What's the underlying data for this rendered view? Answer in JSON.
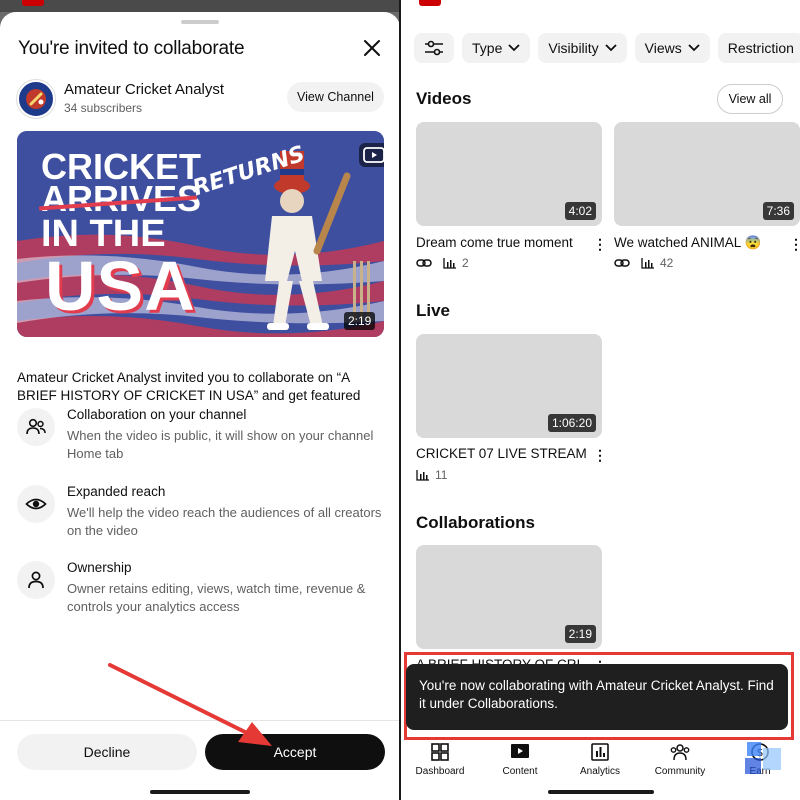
{
  "left": {
    "sheet_title": "You're invited to collaborate",
    "channel": {
      "name": "Amateur Cricket Analyst",
      "subscribers": "34 subscribers",
      "view_channel_label": "View Channel"
    },
    "thumbnail": {
      "line1": "CRICKET",
      "line2": "ARRIVES",
      "line2_overlay": "RETURNS",
      "line3": "IN THE",
      "line4": "USA",
      "duration": "2:19"
    },
    "invite_text": "Amateur Cricket Analyst invited you to collaborate on “A BRIEF HISTORY OF CRICKET IN USA” and get featured",
    "features": [
      {
        "icon": "people-icon",
        "title": "Collaboration on your channel",
        "desc": "When the video is public, it will show on your channel Home tab"
      },
      {
        "icon": "eye-icon",
        "title": "Expanded reach",
        "desc": "We'll help the video reach the audiences of all creators on the video"
      },
      {
        "icon": "person-icon",
        "title": "Ownership",
        "desc": "Owner retains editing, views, watch time, revenue & controls your analytics access"
      }
    ],
    "decline_label": "Decline",
    "accept_label": "Accept"
  },
  "right": {
    "filters": [
      "Type",
      "Visibility",
      "Views",
      "Restriction"
    ],
    "sections": {
      "videos": "Videos",
      "live": "Live",
      "collaborations": "Collaborations"
    },
    "view_all_label": "View all",
    "videos": [
      {
        "title": "Dream come true moment",
        "duration": "4:02",
        "views": "2"
      },
      {
        "title": "We watched ANIMAL 😨",
        "duration": "7:36",
        "views": "42"
      }
    ],
    "live": {
      "title": "CRICKET 07 LIVE STREAM",
      "duration": "1:06:20",
      "views": "11"
    },
    "collaboration": {
      "title": "A BRIEF HISTORY OF CRI",
      "duration": "2:19"
    },
    "toast": "You're now collaborating with Amateur Cricket Analyst. Find it under Collaborations.",
    "nav": [
      "Dashboard",
      "Content",
      "Analytics",
      "Community",
      "Earn"
    ]
  },
  "colors": {
    "accent_red": "#e53935",
    "dark": "#0f0f0f",
    "chip_bg": "#f2f2f2"
  }
}
